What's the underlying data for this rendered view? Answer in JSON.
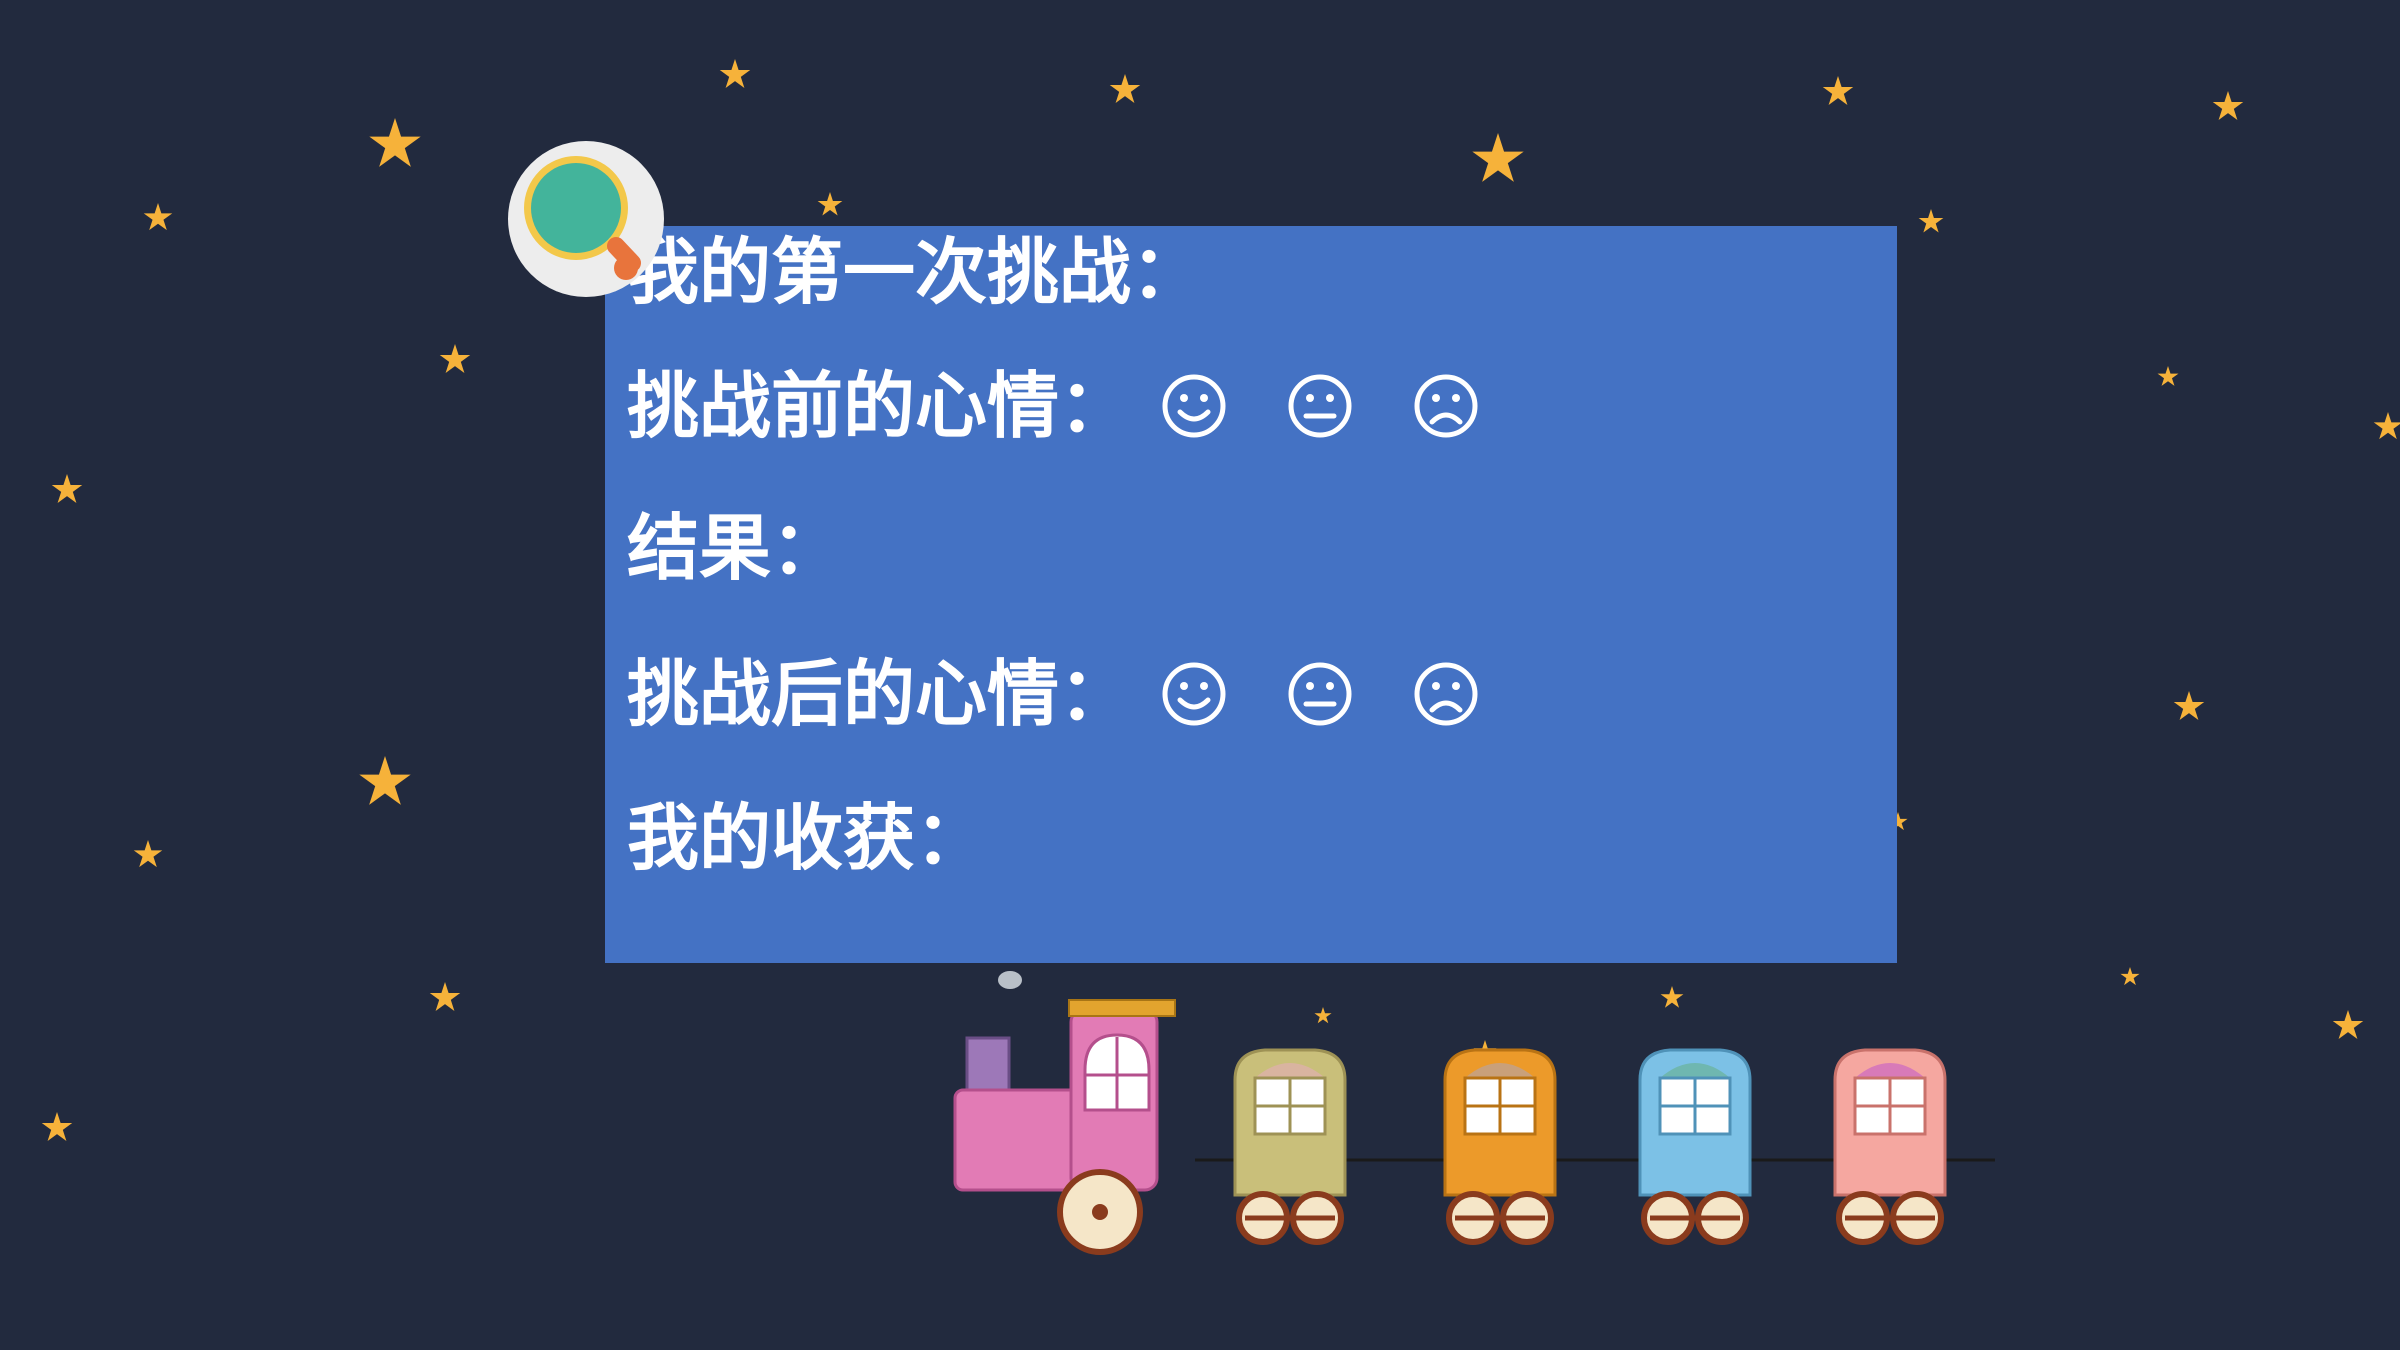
{
  "panel": {
    "first_challenge": "我的第一次挑战：",
    "mood_before": "挑战前的心情：",
    "result": "结果：",
    "mood_after": "挑战后的心情：",
    "harvest": "我的收获："
  },
  "mood_faces": [
    "smiling-face-icon",
    "neutral-face-icon",
    "frowning-face-icon"
  ],
  "colors": {
    "background": "#222a3e",
    "panel": "#4472c4",
    "star": "#f6b23a",
    "text": "#ffffff"
  }
}
